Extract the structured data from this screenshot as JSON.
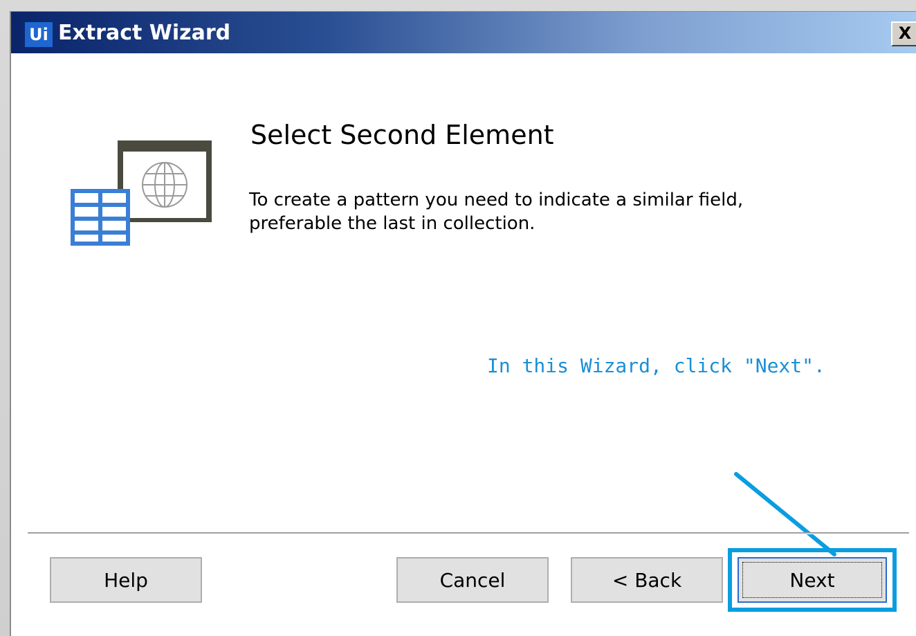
{
  "window": {
    "app_logo": "Ui",
    "title": "Extract Wizard",
    "close_symbol": "X"
  },
  "step": {
    "title": "Select Second Element",
    "description_line1": "To create a pattern you need to indicate a similar field,",
    "description_line2": "preferable the last in collection.",
    "icon": "table-globe-icon"
  },
  "hint": {
    "text": "In this Wizard, click \"Next\".",
    "color": "#1a8fd6"
  },
  "buttons": {
    "help": "Help",
    "cancel": "Cancel",
    "back": "< Back",
    "next": "Next"
  },
  "colors": {
    "highlight": "#0a9de0",
    "titlebar_start": "#0a246a",
    "titlebar_end": "#a6caf0"
  }
}
